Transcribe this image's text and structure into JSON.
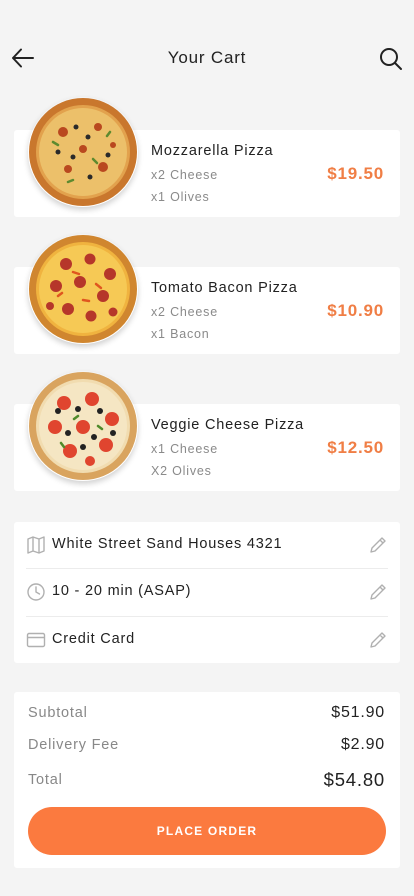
{
  "header": {
    "title": "Your Cart",
    "back_icon": "arrow-left-icon",
    "search_icon": "search-icon"
  },
  "cart": {
    "items": [
      {
        "name": "Mozzarella Pizza",
        "options": [
          "x2 Cheese",
          "x1 Olives"
        ],
        "price": "$19.50"
      },
      {
        "name": "Tomato Bacon Pizza",
        "options": [
          "x2 Cheese",
          "x1 Bacon"
        ],
        "price": "$10.90"
      },
      {
        "name": "Veggie Cheese Pizza",
        "options": [
          "x1 Cheese",
          "X2 Olives"
        ],
        "price": "$12.50"
      }
    ]
  },
  "delivery": {
    "address": "White Street Sand Houses 4321",
    "time": "10 - 20 min (ASAP)",
    "payment": "Credit Card"
  },
  "summary": {
    "subtotal_label": "Subtotal",
    "subtotal_value": "$51.90",
    "fee_label": "Delivery Fee",
    "fee_value": "$2.90",
    "total_label": "Total",
    "total_value": "$54.80",
    "place_order_label": "PLACE ORDER"
  },
  "colors": {
    "accent": "#fb7a3f",
    "price": "#f07e45",
    "background": "#f4f4f4"
  }
}
